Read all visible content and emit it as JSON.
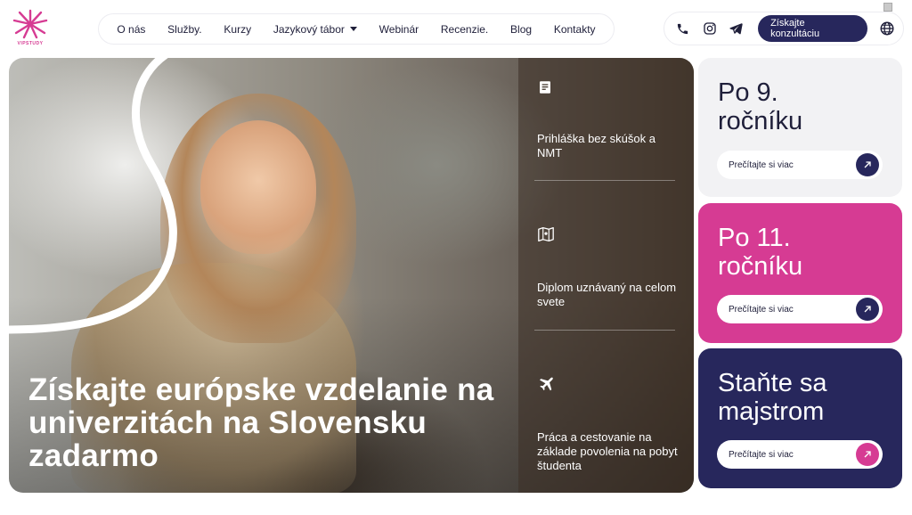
{
  "brand": {
    "logo_text": "VIPSTUDY",
    "accent": "#d63b93",
    "navy": "#27275c"
  },
  "nav": {
    "items": [
      {
        "label": "O nás"
      },
      {
        "label": "Služby."
      },
      {
        "label": "Kurzy"
      },
      {
        "label": "Jazykový tábor",
        "dropdown": true
      },
      {
        "label": "Webinár"
      },
      {
        "label": "Recenzie."
      },
      {
        "label": "Blog"
      },
      {
        "label": "Kontakty"
      }
    ]
  },
  "header_actions": {
    "icons": [
      "phone-icon",
      "instagram-icon",
      "telegram-icon",
      "globe-icon"
    ],
    "consult_label": "Získajte konzultáciu"
  },
  "hero": {
    "title": "Získajte európske vzdelanie na univerzitách na Slovensku zadarmo",
    "features": [
      {
        "icon": "document-icon",
        "text": "Prihláška bez skúšok a NMT"
      },
      {
        "icon": "map-icon",
        "text": "Diplom uznávaný na celom svete"
      },
      {
        "icon": "airplane-icon",
        "text": "Práca a cestovanie na základe povolenia na pobyt študenta"
      }
    ]
  },
  "cards": [
    {
      "title": "Po 9. ročníku",
      "link_label": "Prečítajte si viac",
      "bg": "#f2f2f4",
      "title_color": "#1f1f3a",
      "arrow_bg": "#27275c"
    },
    {
      "title": "Po 11. ročníku",
      "link_label": "Prečítajte si viac",
      "bg": "#d63b93",
      "title_color": "#ffffff",
      "arrow_bg": "#27275c"
    },
    {
      "title": "Staňte sa majstrom",
      "link_label": "Prečítajte si viac",
      "bg": "#27275c",
      "title_color": "#ffffff",
      "arrow_bg": "#d63b93"
    }
  ]
}
